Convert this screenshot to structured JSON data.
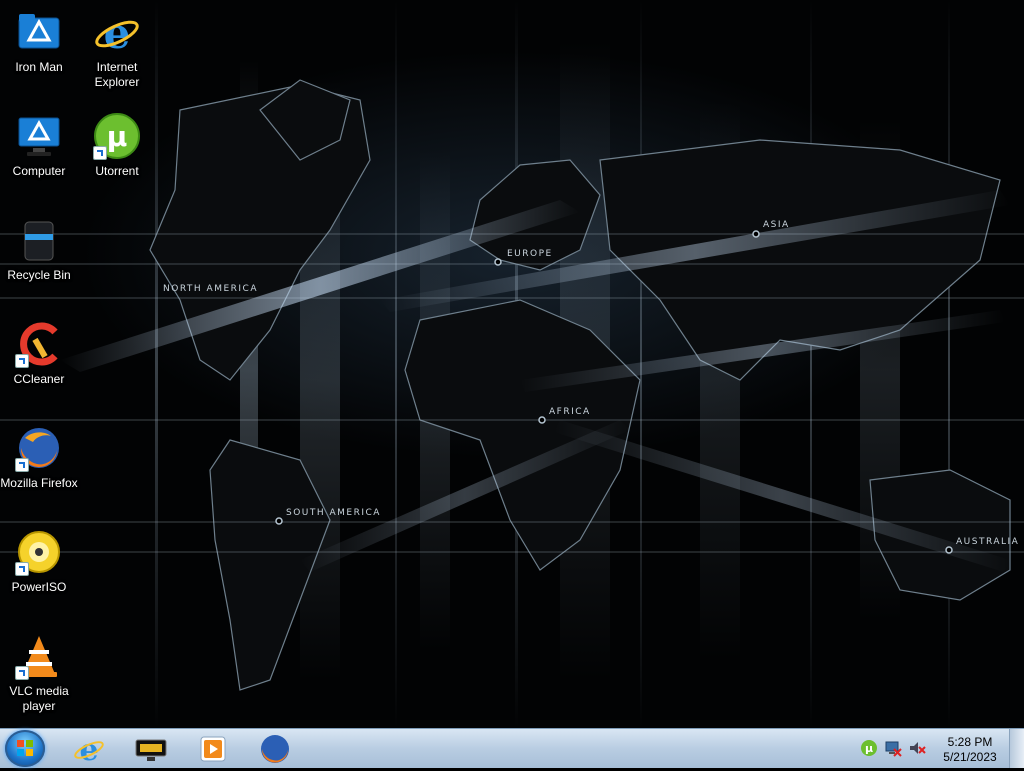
{
  "desktop": {
    "map_labels": [
      "NORTH AMERICA",
      "EUROPE",
      "ASIA",
      "AFRICA",
      "SOUTH AMERICA",
      "AUSTRALIA"
    ],
    "icons": [
      {
        "name": "Iron Man",
        "icon": "folder-icon"
      },
      {
        "name": "Internet Explorer",
        "icon": "internet-explorer-icon"
      },
      {
        "name": "Computer",
        "icon": "computer-icon"
      },
      {
        "name": "Utorrent",
        "icon": "utorrent-icon"
      },
      {
        "name": "Recycle Bin",
        "icon": "recycle-bin-icon"
      },
      {
        "name": "CCleaner",
        "icon": "ccleaner-icon"
      },
      {
        "name": "Mozilla Firefox",
        "icon": "firefox-icon"
      },
      {
        "name": "PowerISO",
        "icon": "poweriso-icon"
      },
      {
        "name": "VLC media player",
        "icon": "vlc-icon"
      }
    ]
  },
  "taskbar": {
    "start": "start-orb-icon",
    "pinned": [
      "internet-explorer-icon",
      "media-center-icon",
      "media-player-icon",
      "firefox-icon"
    ],
    "tray": [
      "utorrent-tray-icon",
      "network-icon",
      "volume-muted-icon"
    ],
    "clock": {
      "time": "5:28 PM",
      "date": "5/21/2023"
    }
  },
  "colors": {
    "taskbar": "#b9cde2",
    "accent": "#1e74c9"
  }
}
